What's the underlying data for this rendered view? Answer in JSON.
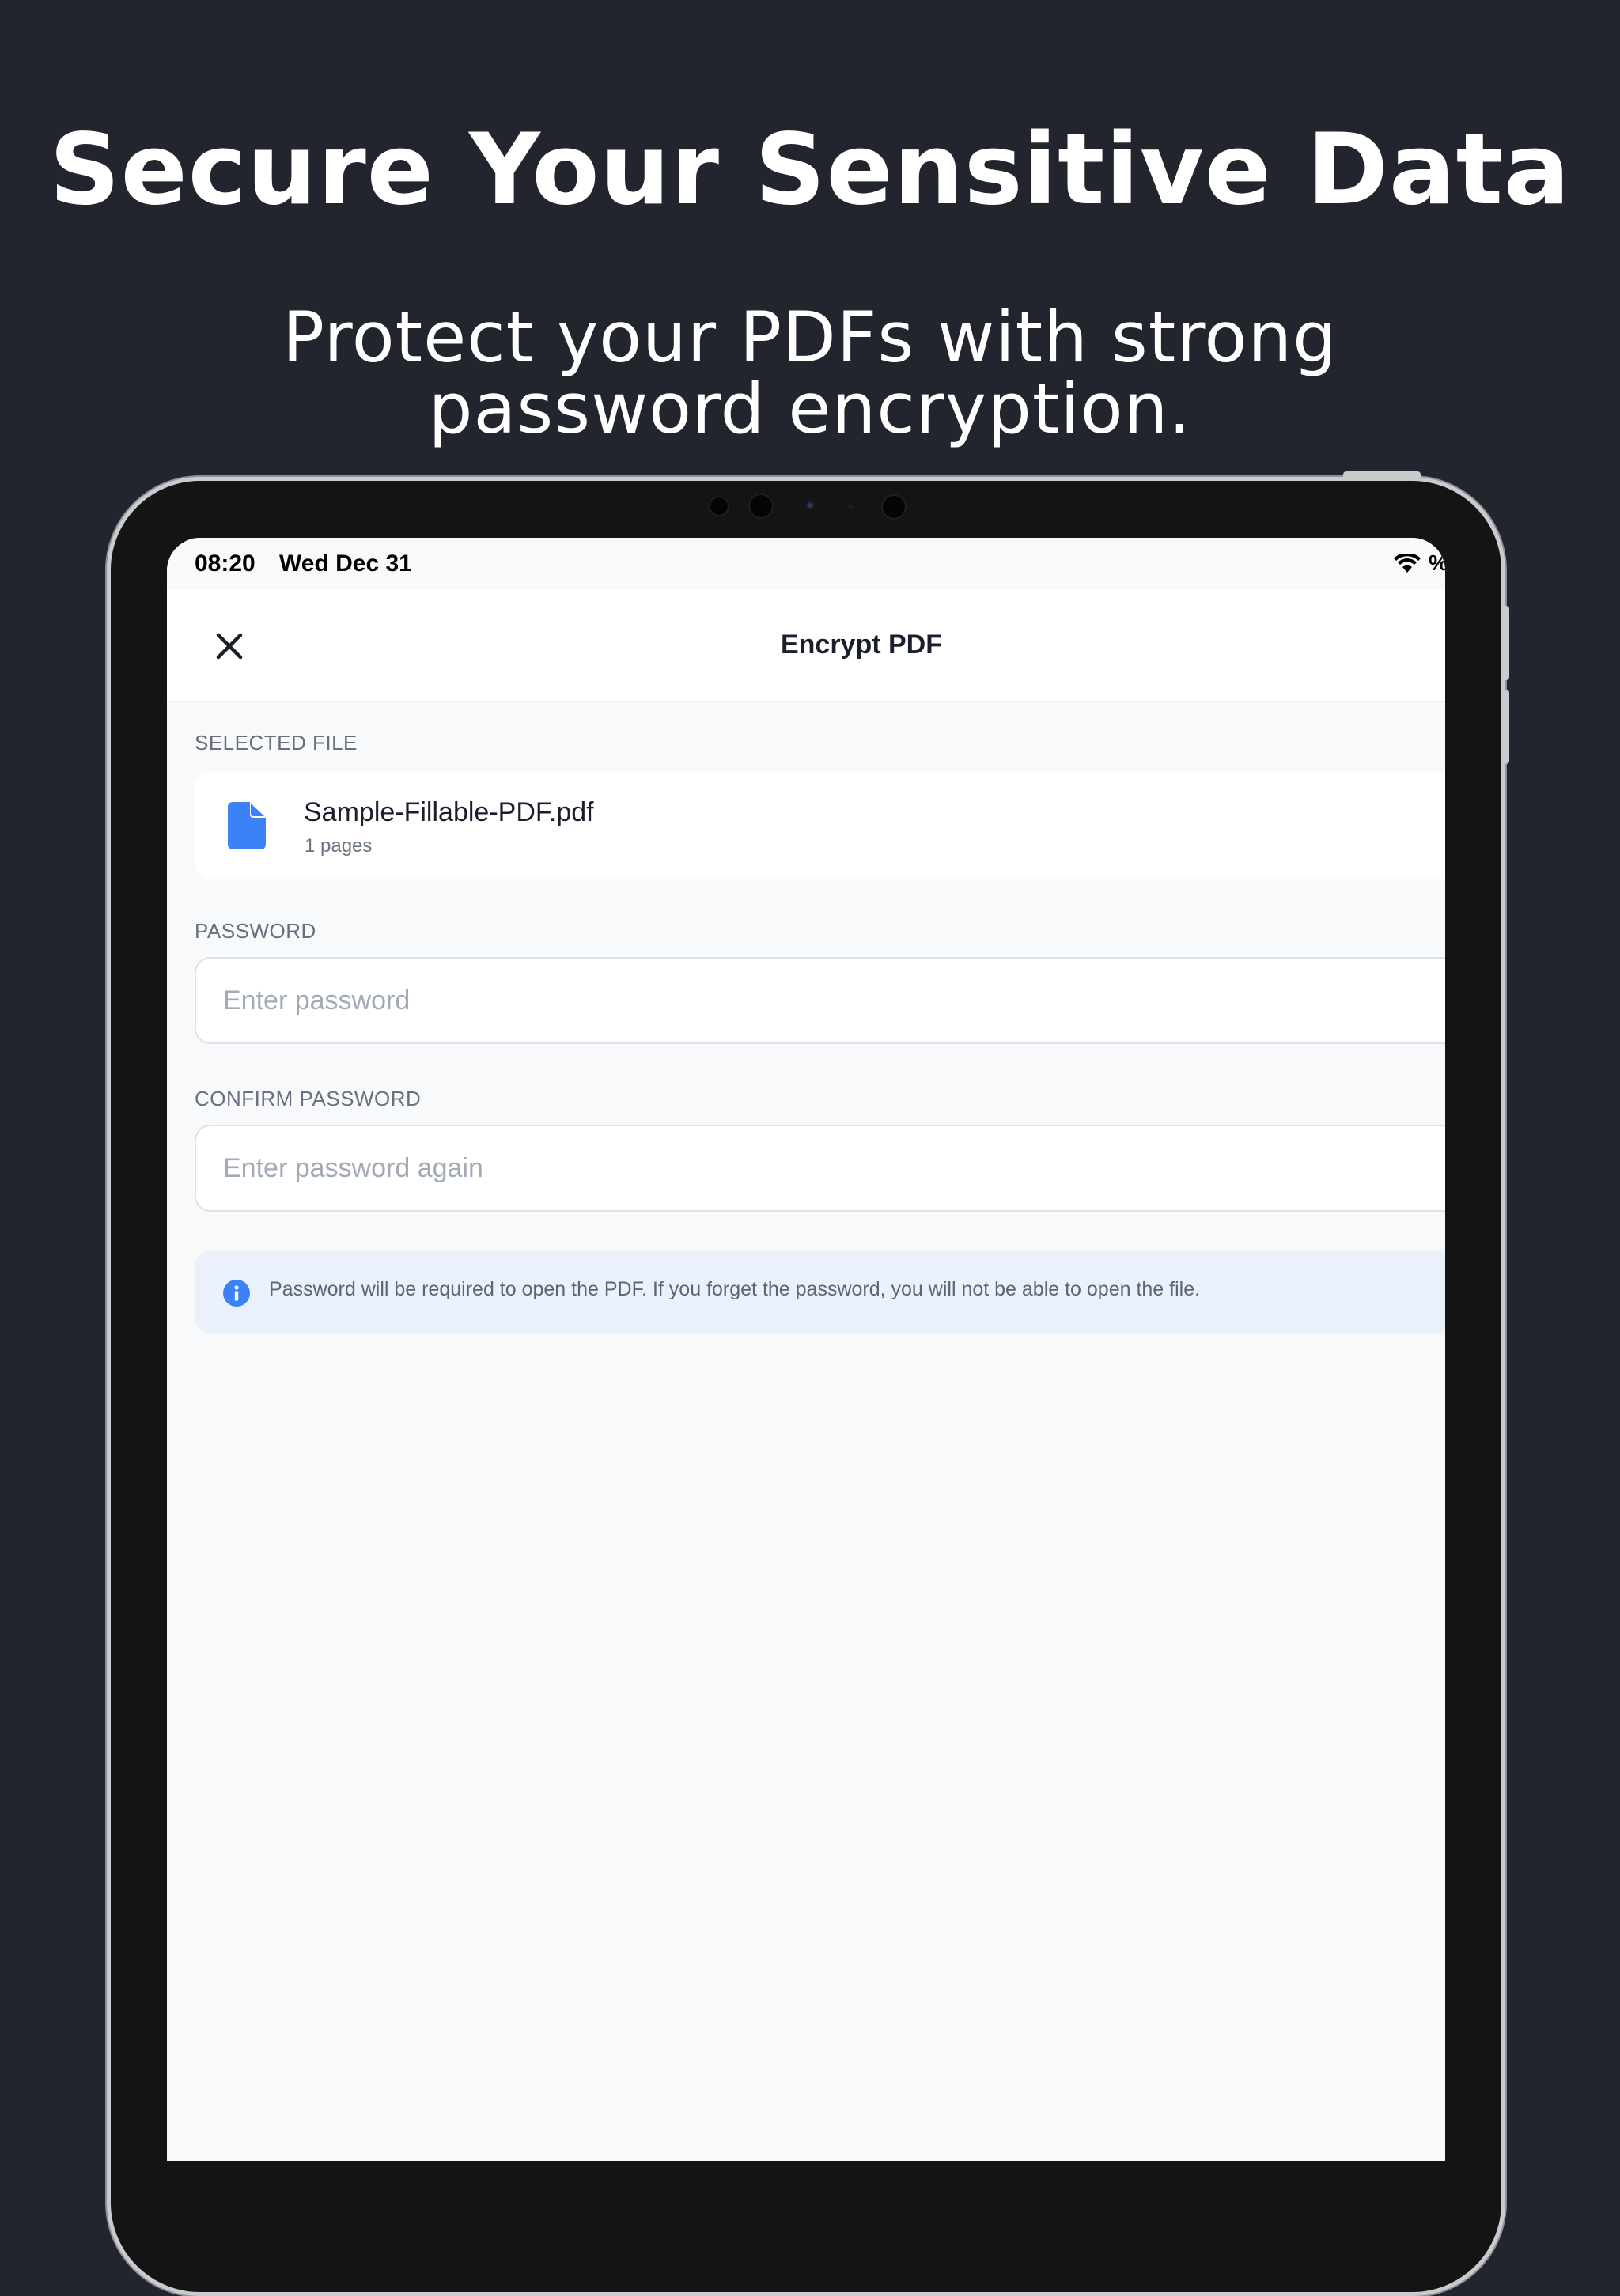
{
  "headline": "Secure Your Sensitive Data",
  "subheadline": {
    "line1": "Protect your PDFs with strong",
    "line2": "password encryption."
  },
  "status_bar": {
    "time": "08:20",
    "date": "Wed Dec 31",
    "battery_text": "%",
    "icons": [
      "wifi-icon"
    ]
  },
  "navbar": {
    "title": "Encrypt PDF",
    "close_icon": "close-icon"
  },
  "selected_file": {
    "section_label": "SELECTED FILE",
    "file_name": "Sample-Fillable-PDF.pdf",
    "pages": "1 pages",
    "icon": "document-icon"
  },
  "password": {
    "label": "PASSWORD",
    "value": "",
    "placeholder": "Enter password"
  },
  "confirm_password": {
    "label": "CONFIRM PASSWORD",
    "value": "",
    "placeholder": "Enter password again"
  },
  "info": {
    "icon": "info-icon",
    "text": "Password will be required to open the PDF. If you forget the password, you will not be able to open the file."
  },
  "colors": {
    "background": "#22252d",
    "accent": "#3b82f6",
    "screen_background": "#f7f9fb",
    "info_background": "#eaf1fb"
  }
}
